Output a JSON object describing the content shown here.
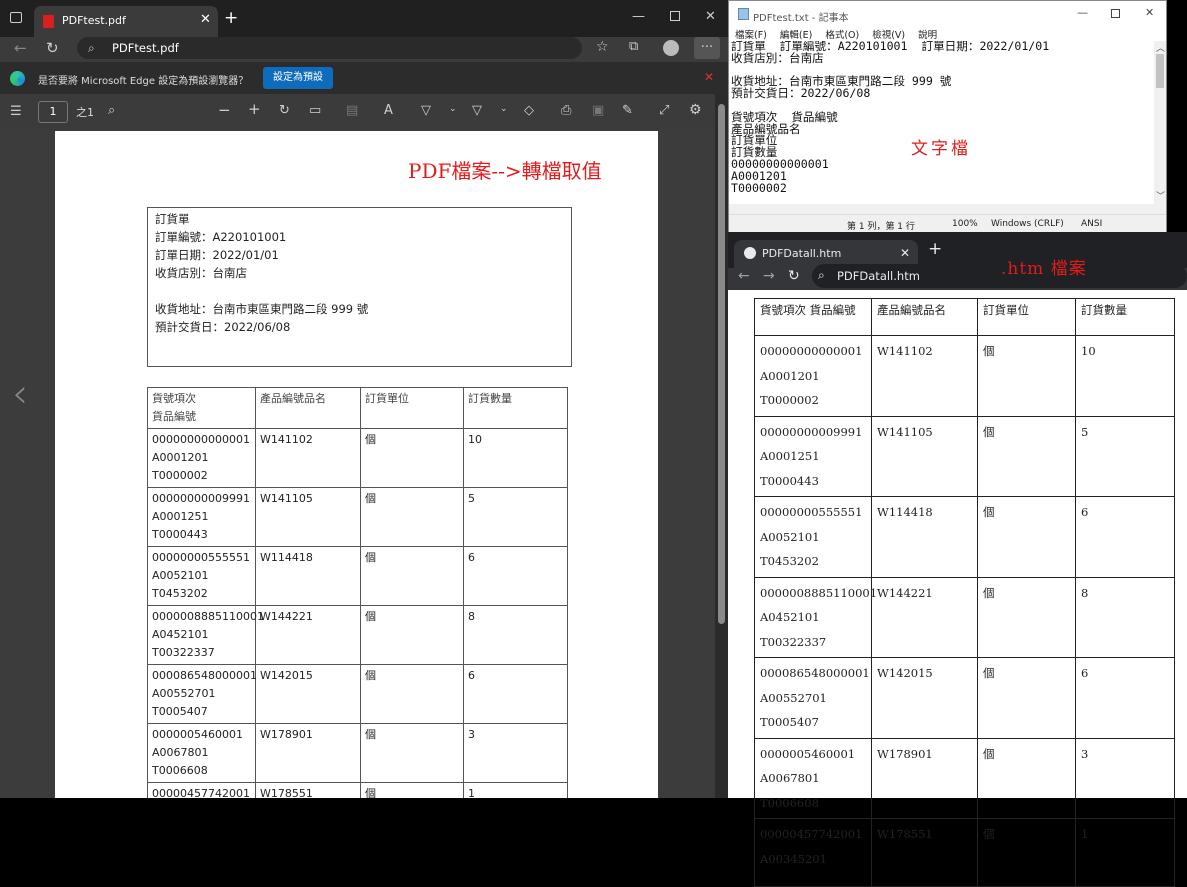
{
  "edge": {
    "tab_title": "PDFtest.pdf",
    "address": "PDFtest.pdf",
    "infobar_text": "是否要將 Microsoft Edge 設定為預設瀏覽器？",
    "infobar_button": "設定為預設",
    "page_number": "1",
    "page_total": "之1",
    "annotation": "PDF檔案-->轉檔取值",
    "header_lines": [
      "訂貨單",
      "訂單編號：A220101001",
      "訂單日期：2022/01/01",
      "收貨店別：台南店",
      "",
      "收貨地址：台南市東區東門路二段 999 號",
      "預計交貨日：2022/06/08"
    ],
    "table_headers": [
      "貨號項次\n貨品編號",
      "產品編號品名",
      "訂貨單位",
      "訂貨數量"
    ]
  },
  "rows": [
    {
      "item": "00000000000001",
      "code": "A0001201",
      "ref": "T0000002",
      "product": "W141102",
      "unit": "個",
      "qty": "10"
    },
    {
      "item": "00000000009991",
      "code": "A0001251",
      "ref": "T0000443",
      "product": "W141105",
      "unit": "個",
      "qty": "5"
    },
    {
      "item": "00000000555551",
      "code": "A0052101",
      "ref": "T0453202",
      "product": "W114418",
      "unit": "個",
      "qty": "6"
    },
    {
      "item": "0000008885110001",
      "code": "A0452101",
      "ref": "T00322337",
      "product": "W144221",
      "unit": "個",
      "qty": "8"
    },
    {
      "item": "000086548000001",
      "code": "A00552701",
      "ref": "T0005407",
      "product": "W142015",
      "unit": "個",
      "qty": "6"
    },
    {
      "item": "0000005460001",
      "code": "A0067801",
      "ref": "T0006608",
      "product": "W178901",
      "unit": "個",
      "qty": "3"
    },
    {
      "item": "00000457742001",
      "code": "A00345201",
      "ref": "",
      "product": "W178551",
      "unit": "個",
      "qty": "1"
    }
  ],
  "notepad": {
    "title": "PDFtest.txt - 記事本",
    "menus": [
      "檔案(F)",
      "編輯(E)",
      "格式(O)",
      "檢視(V)",
      "說明"
    ],
    "lines": [
      "訂貨單  訂單編號：A220101001  訂單日期：2022/01/01",
      "收貨店別：台南店",
      "",
      "收貨地址：台南市東區東門路二段 999 號",
      "預計交貨日：2022/06/08",
      "",
      "貨號項次  貨品編號",
      "產品編號品名",
      "訂貨單位",
      "訂貨數量",
      "00000000000001",
      "A0001201",
      "T0000002"
    ],
    "annotation": "文字檔",
    "status_position": "第 1 列，第 1 行",
    "status_zoom": "100%",
    "status_eol": "Windows (CRLF)",
    "status_encoding": "ANSI"
  },
  "chrome": {
    "tab_title": "PDFDatall.htm",
    "address": "PDFDatall.htm",
    "annotation": ".htm 檔案",
    "table_headers": [
      "貨號項次 貨品編號",
      "產品編號品名",
      "訂貨單位",
      "訂貨數量"
    ]
  },
  "colors": {
    "annotation_red": "#e21c1c",
    "edge_accent": "#0f6cbd"
  }
}
